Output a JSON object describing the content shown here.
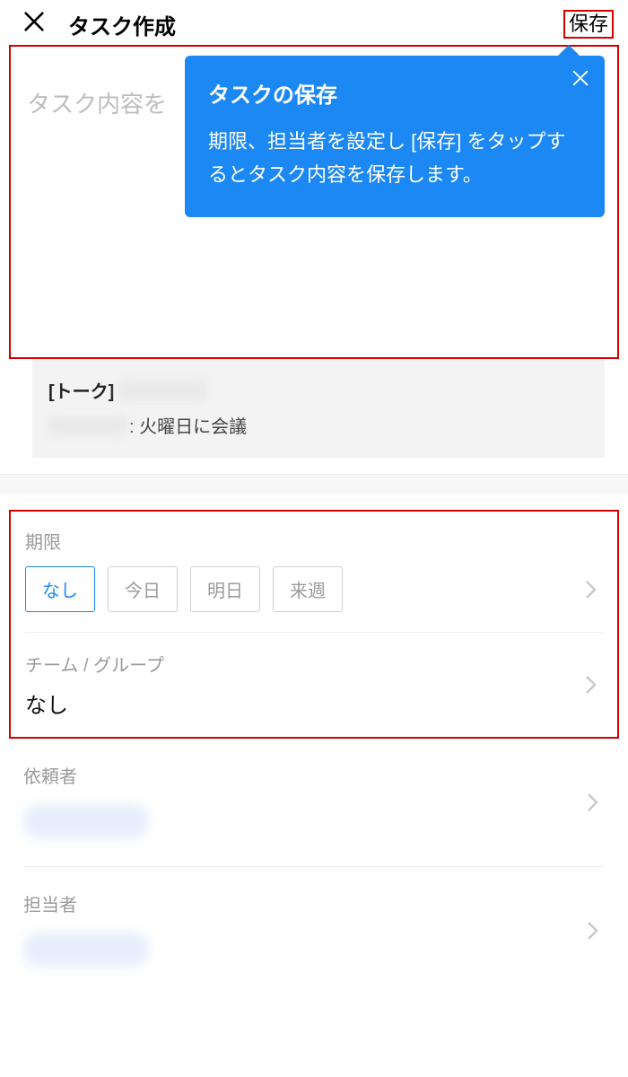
{
  "header": {
    "title": "タスク作成",
    "save_label": "保存"
  },
  "task": {
    "placeholder": "タスク内容を"
  },
  "tooltip": {
    "title": "タスクの保存",
    "body": "期限、担当者を設定し [保存] をタップするとタスク内容を保存します。"
  },
  "talk": {
    "prefix": "[トーク]",
    "message_suffix": ": 火曜日に会議"
  },
  "deadline": {
    "label": "期限",
    "options": [
      "なし",
      "今日",
      "明日",
      "来週"
    ],
    "selected": "なし"
  },
  "team": {
    "label": "チーム / グループ",
    "value": "なし"
  },
  "requester": {
    "label": "依頼者"
  },
  "assignee": {
    "label": "担当者"
  }
}
